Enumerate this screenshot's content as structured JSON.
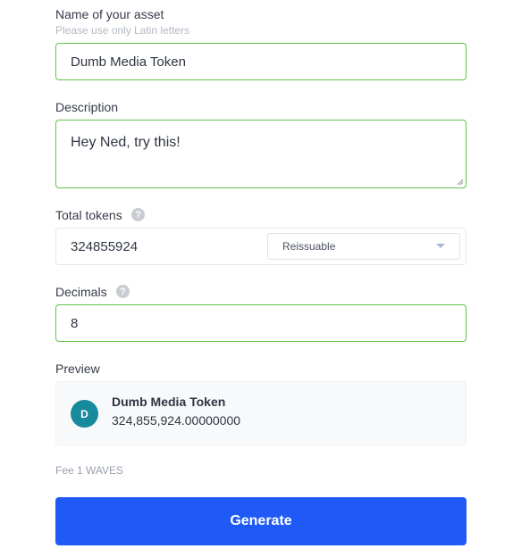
{
  "asset_name": {
    "label": "Name of your asset",
    "hint": "Please use only Latin letters",
    "value": "Dumb Media Token"
  },
  "description": {
    "label": "Description",
    "value": "Hey Ned, try this!"
  },
  "total_tokens": {
    "label": "Total tokens",
    "help_icon": "question-mark",
    "value": "324855924",
    "reissuable_select": "Reissuable"
  },
  "decimals": {
    "label": "Decimals",
    "help_icon": "question-mark",
    "value": "8"
  },
  "preview": {
    "label": "Preview",
    "avatar_letter": "D",
    "avatar_color": "#178a9c",
    "name": "Dumb Media Token",
    "amount": "324,855,924.00000000"
  },
  "fee": "Fee 1 WAVES",
  "generate_label": "Generate",
  "colors": {
    "accent": "#1f5af6",
    "valid_border": "#5fc24a"
  }
}
